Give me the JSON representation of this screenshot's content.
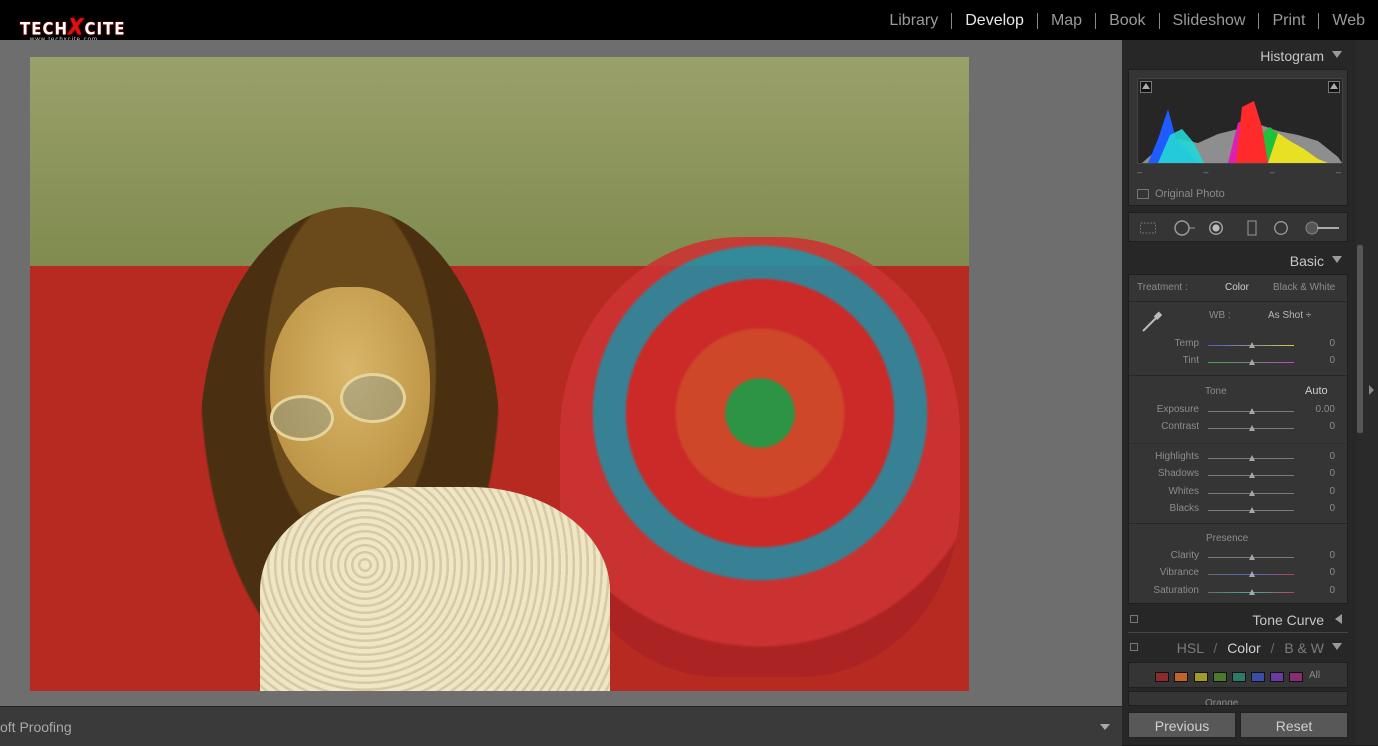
{
  "brand": {
    "name": "TECHXCITE",
    "prefix": "TECH",
    "x": "X",
    "suffix": "CITE",
    "url": "www.techxcite.com"
  },
  "modules": [
    "Library",
    "Develop",
    "Map",
    "Book",
    "Slideshow",
    "Print",
    "Web"
  ],
  "active_module": "Develop",
  "histogram": {
    "title": "Histogram",
    "dashes": [
      "–",
      "–",
      "–",
      "–"
    ],
    "original_photo_label": "Original Photo",
    "colors": {
      "blue": "#1f5bff",
      "cyan": "#22d6d6",
      "green": "#21c03a",
      "magenta": "#e01fb0",
      "red": "#ff2a2a",
      "yellow": "#e8e023",
      "gray": "#a9a9a9"
    }
  },
  "tools": [
    "crop-icon",
    "spot-removal-icon",
    "red-eye-icon",
    "graduated-filter-icon",
    "radial-filter-icon",
    "adjustment-brush-icon"
  ],
  "basic": {
    "title": "Basic",
    "treatment_label": "Treatment :",
    "treatment_color": "Color",
    "treatment_bw": "Black & White",
    "wb_label": "WB :",
    "wb_value": "As Shot ÷",
    "temp": {
      "label": "Temp",
      "value": "0"
    },
    "tint": {
      "label": "Tint",
      "value": "0"
    },
    "tone_label": "Tone",
    "auto_label": "Auto",
    "exposure": {
      "label": "Exposure",
      "value": "0.00"
    },
    "contrast": {
      "label": "Contrast",
      "value": "0"
    },
    "highlights": {
      "label": "Highlights",
      "value": "0"
    },
    "shadows": {
      "label": "Shadows",
      "value": "0"
    },
    "whites": {
      "label": "Whites",
      "value": "0"
    },
    "blacks": {
      "label": "Blacks",
      "value": "0"
    },
    "presence_label": "Presence",
    "clarity": {
      "label": "Clarity",
      "value": "0"
    },
    "vibrance": {
      "label": "Vibrance",
      "value": "0"
    },
    "saturation": {
      "label": "Saturation",
      "value": "0"
    }
  },
  "tone_curve": {
    "title": "Tone Curve"
  },
  "hsl": {
    "hsl_label": "HSL",
    "slash1": "/",
    "color_label": "Color",
    "slash2": "/",
    "bw_label": "B & W",
    "all_label": "All",
    "orange_label": "Orange",
    "swatches": [
      "#8a2c2c",
      "#c0642a",
      "#a39a2a",
      "#4c7a2c",
      "#2c7a6a",
      "#3a4ea8",
      "#6a3aa0",
      "#8a2c74"
    ]
  },
  "bottom": {
    "soft_proofing": "oft Proofing"
  },
  "buttons": {
    "previous": "Previous",
    "reset": "Reset"
  }
}
